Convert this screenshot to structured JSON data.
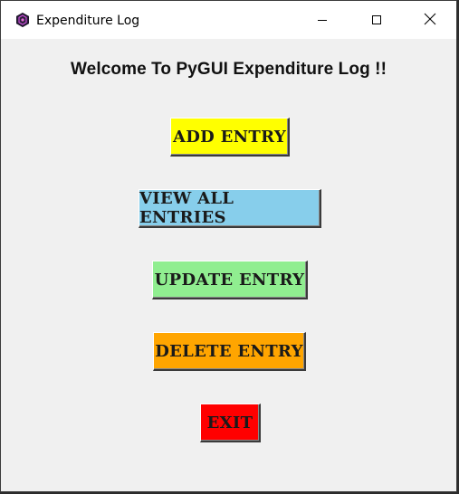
{
  "window": {
    "title": "Expenditure Log",
    "app_icon": "hexagon-app-icon",
    "controls": [
      "minimize-icon",
      "maximize-icon",
      "close-icon"
    ]
  },
  "main": {
    "heading": "Welcome To PyGUI Expenditure Log !!"
  },
  "buttons": {
    "add": {
      "label": "ADD ENTRY",
      "color": "#ffff00"
    },
    "view": {
      "label": "VIEW ALL ENTRIES",
      "color": "#87ceeb"
    },
    "update": {
      "label": "UPDATE ENTRY",
      "color": "#90ee90"
    },
    "delete": {
      "label": "DELETE ENTRY",
      "color": "#ffa500"
    },
    "exit": {
      "label": "EXIT",
      "color": "#ff0000"
    }
  }
}
